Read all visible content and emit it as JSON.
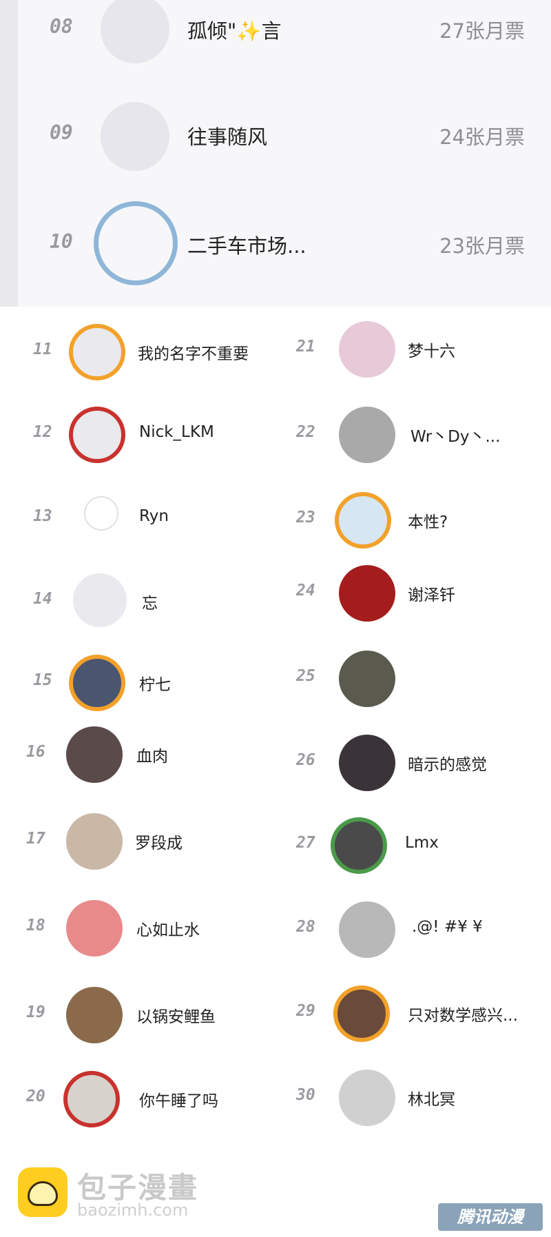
{
  "top_ranks": [
    {
      "rank": "08",
      "name": "孤倾\"✨言",
      "votes": "27张月票"
    },
    {
      "rank": "09",
      "name": "往事随风",
      "votes": "24张月票"
    },
    {
      "rank": "10",
      "name": "二手车市场...",
      "votes": "23张月票"
    }
  ],
  "left_column": [
    {
      "rank": "11",
      "name": "我的名字不重要"
    },
    {
      "rank": "12",
      "name": "Nick_LKM"
    },
    {
      "rank": "13",
      "name": "Ryn"
    },
    {
      "rank": "14",
      "name": "忘"
    },
    {
      "rank": "15",
      "name": "柠七"
    },
    {
      "rank": "16",
      "name": "血肉"
    },
    {
      "rank": "17",
      "name": "罗段成"
    },
    {
      "rank": "18",
      "name": "心如止水"
    },
    {
      "rank": "19",
      "name": "以锅安鲤鱼"
    },
    {
      "rank": "20",
      "name": "你午睡了吗"
    }
  ],
  "right_column": [
    {
      "rank": "21",
      "name": "梦十六"
    },
    {
      "rank": "22",
      "name": "Wr丶Dy丶..."
    },
    {
      "rank": "23",
      "name": "本性?"
    },
    {
      "rank": "24",
      "name": "谢泽钎"
    },
    {
      "rank": "25",
      "name": ""
    },
    {
      "rank": "26",
      "name": "暗示的感觉"
    },
    {
      "rank": "27",
      "name": "Lmx"
    },
    {
      "rank": "28",
      "name": ".@! #¥ ¥"
    },
    {
      "rank": "29",
      "name": "只对数学感兴..."
    },
    {
      "rank": "30",
      "name": "林北冥"
    }
  ],
  "footer": {
    "brand": "包子漫畫",
    "domain": "baozimh.com",
    "watermark": "腾讯动漫"
  }
}
